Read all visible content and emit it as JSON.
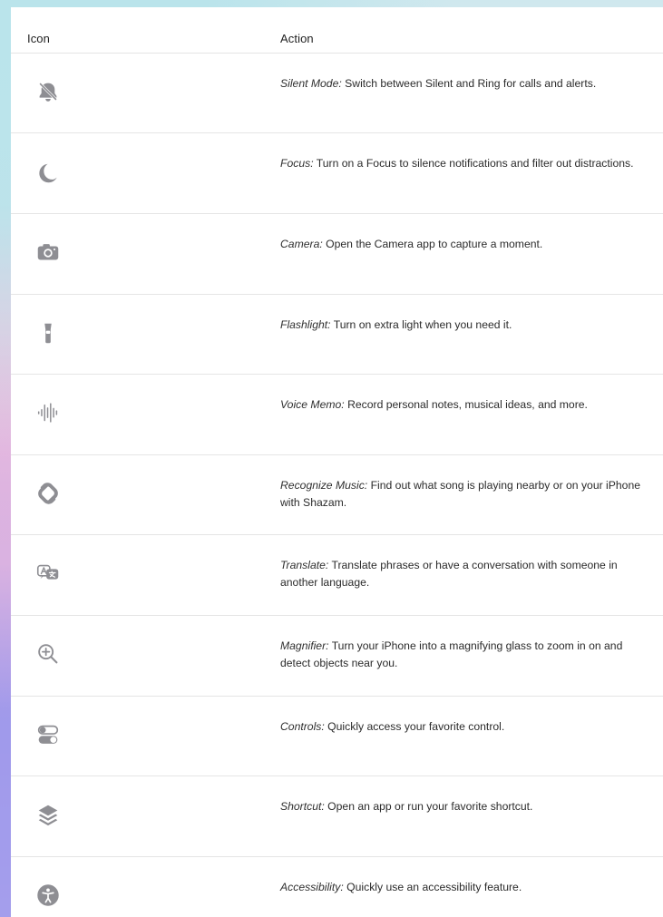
{
  "header": {
    "icon_label": "Icon",
    "action_label": "Action"
  },
  "colors": {
    "icon_gray": "#8e8e93",
    "text": "#2b2b2b",
    "divider": "#e5e5e5"
  },
  "rows": [
    {
      "icon_name": "bell-slash-icon",
      "title": "Silent Mode:",
      "description": "Switch between Silent and Ring for calls and alerts."
    },
    {
      "icon_name": "moon-icon",
      "title": "Focus:",
      "description": "Turn on a Focus to silence notifications and filter out distractions."
    },
    {
      "icon_name": "camera-icon",
      "title": "Camera:",
      "description": "Open the Camera app to capture a moment."
    },
    {
      "icon_name": "flashlight-icon",
      "title": "Flashlight:",
      "description": "Turn on extra light when you need it."
    },
    {
      "icon_name": "waveform-icon",
      "title": "Voice Memo:",
      "description": "Record personal notes, musical ideas, and more."
    },
    {
      "icon_name": "shazam-icon",
      "title": "Recognize Music:",
      "description": "Find out what song is playing nearby or on your iPhone with Shazam."
    },
    {
      "icon_name": "translate-icon",
      "title": "Translate:",
      "description": "Translate phrases or have a conversation with someone in another language."
    },
    {
      "icon_name": "magnifier-icon",
      "title": "Magnifier:",
      "description": "Turn your iPhone into a magnifying glass to zoom in on and detect objects near you."
    },
    {
      "icon_name": "controls-toggle-icon",
      "title": "Controls:",
      "description": "Quickly access your favorite control."
    },
    {
      "icon_name": "shortcuts-icon",
      "title": "Shortcut:",
      "description": "Open an app or run your favorite shortcut."
    },
    {
      "icon_name": "accessibility-icon",
      "title": "Accessibility:",
      "description": "Quickly use an accessibility feature."
    }
  ]
}
